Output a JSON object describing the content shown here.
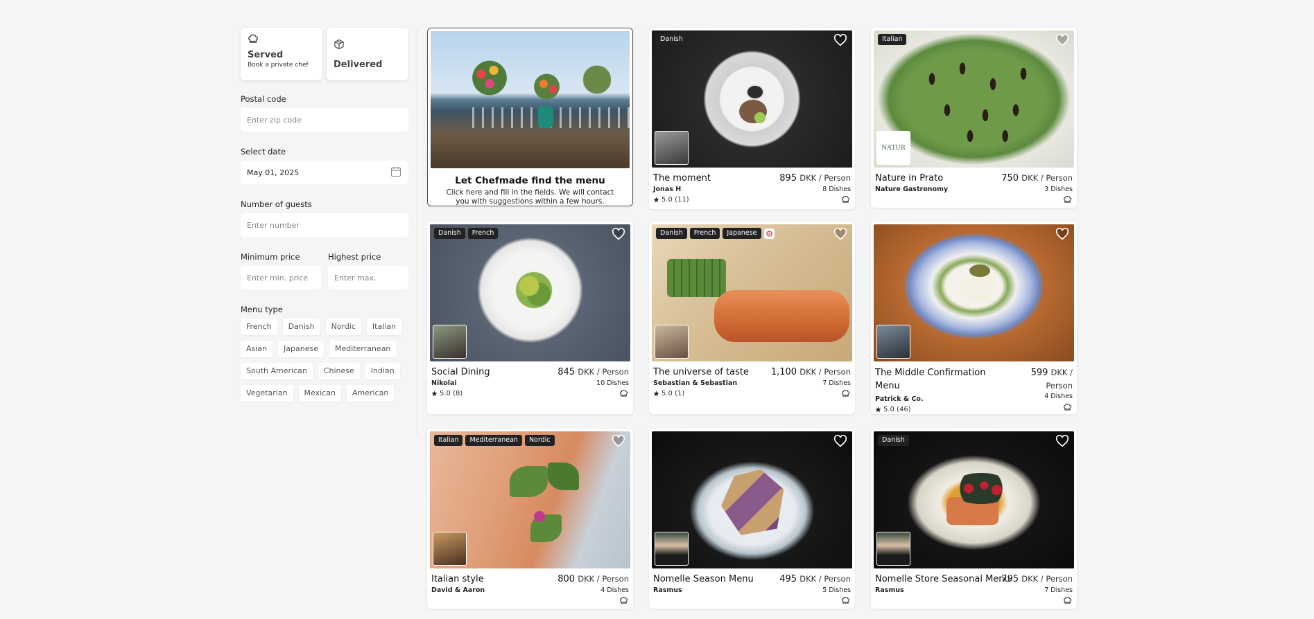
{
  "sidebar": {
    "served": {
      "title": "Served",
      "subtitle": "Book a private chef"
    },
    "delivered": {
      "title": "Delivered"
    },
    "postal": {
      "label": "Postal code",
      "placeholder": "Enter zip code"
    },
    "date": {
      "label": "Select date",
      "value": "May 01, 2025"
    },
    "guests": {
      "label": "Number of guests",
      "placeholder": "Enter number"
    },
    "min_price": {
      "label": "Minimum price",
      "placeholder": "Enter min. price"
    },
    "max_price": {
      "label": "Highest price",
      "placeholder": "Enter max."
    },
    "menu_type": {
      "label": "Menu type"
    },
    "chips": [
      "French",
      "Danish",
      "Nordic",
      "Italian",
      "Asian",
      "Japanese",
      "Mediterranean",
      "South American",
      "Chinese",
      "Indian",
      "Vegetarian",
      "Mexican",
      "American"
    ]
  },
  "promo": {
    "title": "Let Chefmade find the menu",
    "text": "Click here and fill in the fields. We will contact you with suggestions within a few hours."
  },
  "cards": [
    {
      "title": "The moment",
      "price": "895",
      "unit": "DKK / Person",
      "chef": "Jonas H",
      "dishes": "8 Dishes",
      "rating": "5.0 (11)",
      "tags": [
        "Danish"
      ]
    },
    {
      "title": "Nature in Prato",
      "price": "750",
      "unit": "DKK / Person",
      "chef": "Nature Gastronomy",
      "dishes": "3 Dishes",
      "rating": "",
      "tags": [
        "Italian"
      ],
      "avatar_text": "NATUR"
    },
    {
      "title": "Social Dining",
      "price": "845",
      "unit": "DKK / Person",
      "chef": "Nikolai",
      "dishes": "10 Dishes",
      "rating": "5.0 (8)",
      "tags": [
        "Danish",
        "French"
      ]
    },
    {
      "title": "The universe of taste",
      "price": "1,100",
      "unit": "DKK / Person",
      "chef": "Sebastian & Sebastian",
      "dishes": "7 Dishes",
      "rating": "5.0 (1)",
      "tags": [
        "Danish",
        "French",
        "Japanese"
      ]
    },
    {
      "title": "The Middle Confirmation Menu",
      "price": "599",
      "unit_a": "DKK /",
      "unit_b": "Person",
      "chef": "Patrick & Co.",
      "dishes": "4 Dishes",
      "rating": "5.0 (46)",
      "tags": []
    },
    {
      "title": "Italian style",
      "price": "800",
      "unit": "DKK / Person",
      "chef": "David & Aaron",
      "dishes": "4 Dishes",
      "rating": "",
      "tags": [
        "Italian",
        "Mediterranean",
        "Nordic"
      ]
    },
    {
      "title": "Nomelle Season Menu",
      "price": "495",
      "unit": "DKK / Person",
      "chef": "Rasmus",
      "dishes": "5 Dishes",
      "rating": "",
      "tags": []
    },
    {
      "title": "Nomelle Store Seasonal Menu",
      "price": "795",
      "unit": "DKK / Person",
      "chef": "Rasmus",
      "dishes": "7 Dishes",
      "rating": "",
      "tags": [
        "Danish"
      ]
    }
  ],
  "colors": {
    "background": "#f5f5f5",
    "tag_bg": "#222222",
    "card_bg": "#ffffff"
  }
}
